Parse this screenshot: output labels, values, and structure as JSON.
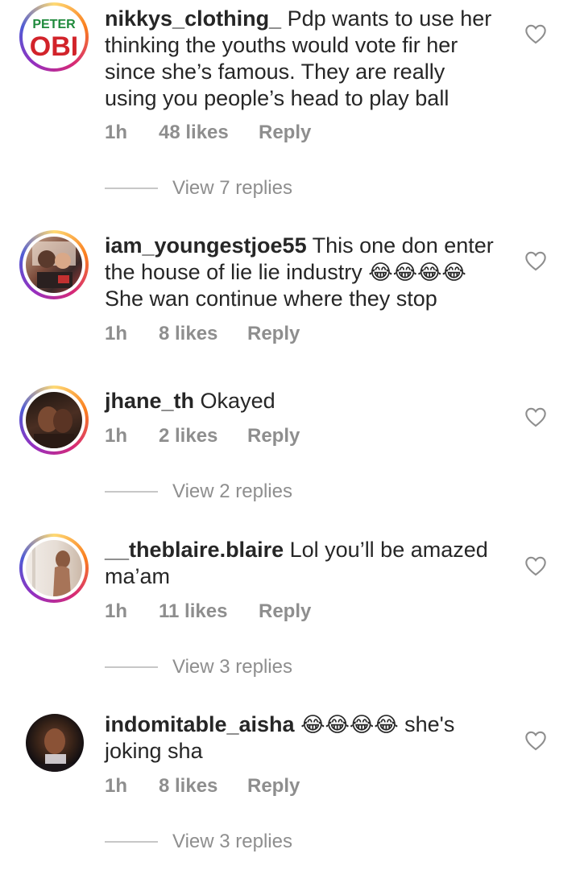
{
  "comments": [
    {
      "username": "nikkys_clothing_",
      "text": "Pdp wants to use her thinking the youths would vote fir her since she’s famous. They are really using you people’s head to play ball",
      "time": "1h",
      "likes": "48 likes",
      "reply": "Reply",
      "view_replies": "View 7 replies",
      "avatar_logo_top": "PETER",
      "avatar_logo_bottom": "OBI"
    },
    {
      "username": "iam_youngestjoe55",
      "text": "This one don enter the house of lie lie industry",
      "emojis": "😂😂😂😂",
      "text_after": "She wan continue where they stop",
      "time": "1h",
      "likes": "8 likes",
      "reply": "Reply"
    },
    {
      "username": "jhane_th",
      "text": "Okayed",
      "time": "1h",
      "likes": "2 likes",
      "reply": "Reply",
      "view_replies": "View 2 replies"
    },
    {
      "username": "__theblaire.blaire",
      "text": "Lol you’ll be amazed ma’am",
      "time": "1h",
      "likes": "11 likes",
      "reply": "Reply",
      "view_replies": "View 3 replies"
    },
    {
      "username": "indomitable_aisha",
      "emojis": "😂😂😂😂",
      "text": "she's joking sha",
      "time": "1h",
      "likes": "8 likes",
      "reply": "Reply",
      "view_replies": "View 3 replies"
    }
  ],
  "colors": {
    "text": "#262626",
    "muted": "#8e8e8e",
    "logo_green": "#1f8a3c",
    "logo_red": "#d2232a"
  },
  "icons": {
    "like": "heart-outline-icon"
  }
}
